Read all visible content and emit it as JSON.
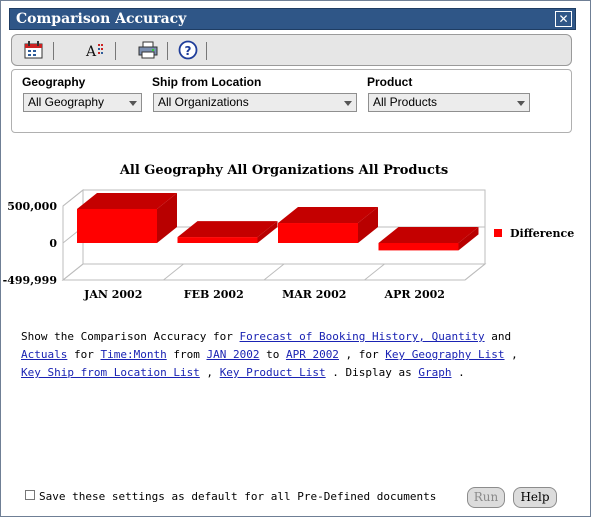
{
  "window": {
    "title": "Comparison Accuracy",
    "close_glyph": "✕"
  },
  "toolbar": {
    "icons": [
      "calendar-icon",
      "font-format-icon",
      "print-icon",
      "help-icon"
    ],
    "help_glyph": "?"
  },
  "filters": {
    "geography": {
      "label": "Geography",
      "value": "All Geography"
    },
    "ship_from": {
      "label": "Ship from Location",
      "value": "All Organizations"
    },
    "product": {
      "label": "Product",
      "value": "All Products"
    }
  },
  "chart_data": {
    "type": "bar",
    "title": "All Geography All Organizations All Products",
    "categories": [
      "JAN 2002",
      "FEB 2002",
      "MAR 2002",
      "APR 2002"
    ],
    "series": [
      {
        "name": "Difference",
        "values": [
          460000,
          80000,
          270000,
          -100000
        ],
        "color": "#ff0000"
      }
    ],
    "y_tick_labels": [
      "500,000",
      "0",
      "-499,999"
    ],
    "ylim": [
      -499999,
      500000
    ],
    "legend": "right",
    "grid": true
  },
  "sentence": {
    "t1": "Show the Comparison Accuracy for ",
    "l1": "Forecast of Booking History, Quantity",
    "t2": " and ",
    "l2": "Actuals",
    "t3": " for ",
    "l3": "Time:Month",
    "t4": " from ",
    "l4": "JAN 2002",
    "t5": " to ",
    "l5": "APR 2002",
    "t6": " , for ",
    "l6": "Key Geography List",
    "t7": " , ",
    "l7": "Key Ship from Location List",
    "t8": " , ",
    "l8": "Key Product List",
    "t9": " . Display as ",
    "l9": "Graph",
    "t10": " ."
  },
  "footer": {
    "checkbox_label": "Save these settings as default for all Pre-Defined documents",
    "run_label": "Run",
    "help_label": "Help"
  }
}
